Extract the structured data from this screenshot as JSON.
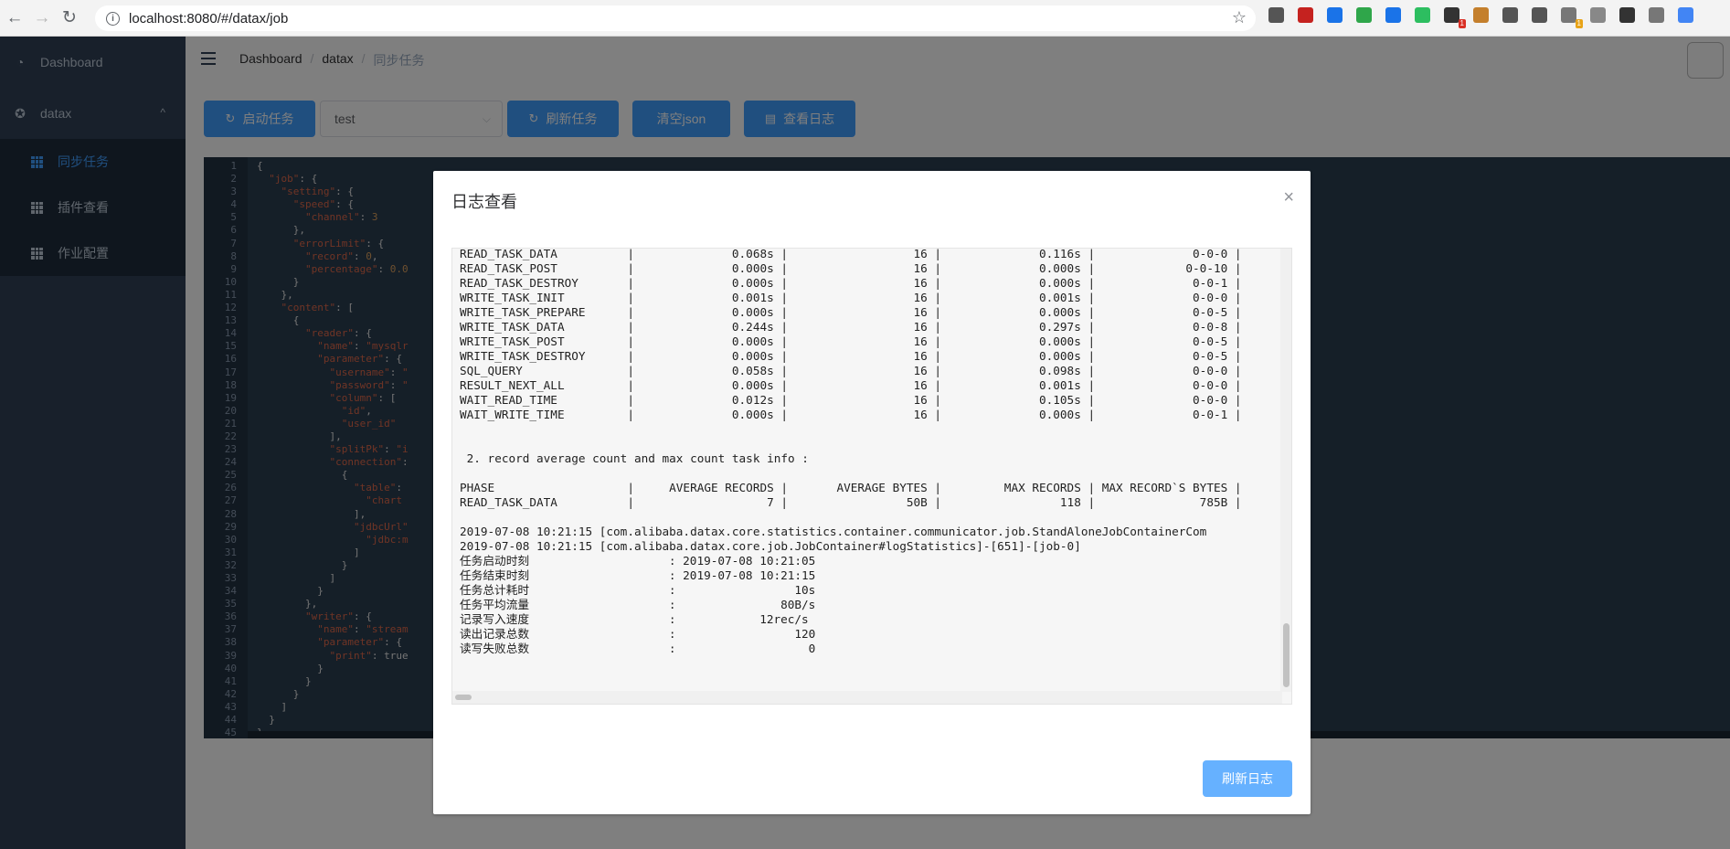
{
  "browser": {
    "back": "←",
    "forward": "→",
    "reload": "↻",
    "url": "localhost:8080/#/datax/job",
    "star": "☆",
    "extensions": [
      {
        "color": "#555555",
        "badge": ""
      },
      {
        "color": "#c5221f",
        "badge": ""
      },
      {
        "color": "#1a73e8",
        "badge": ""
      },
      {
        "color": "#2fa64a",
        "badge": ""
      },
      {
        "color": "#1a73e8",
        "badge": ""
      },
      {
        "color": "#2dbe60",
        "badge": ""
      },
      {
        "color": "#333333",
        "badge": "1"
      },
      {
        "color": "#c47f2c",
        "badge": ""
      },
      {
        "color": "#555555",
        "badge": ""
      },
      {
        "color": "#555555",
        "badge": ""
      },
      {
        "color": "#777777",
        "badge": "1"
      },
      {
        "color": "#888888",
        "badge": ""
      },
      {
        "color": "#333333",
        "badge": ""
      },
      {
        "color": "#777777",
        "badge": ""
      },
      {
        "color": "#4285f4",
        "badge": ""
      }
    ]
  },
  "sidebar": {
    "dashboard": {
      "label": "Dashboard",
      "icon": "dashboard-icon"
    },
    "datax": {
      "label": "datax",
      "icon": "datax-icon",
      "arrow": "^"
    },
    "items": [
      {
        "label": "同步任务",
        "active": true
      },
      {
        "label": "插件查看",
        "active": false
      },
      {
        "label": "作业配置",
        "active": false
      }
    ]
  },
  "breadcrumb": {
    "items": [
      "Dashboard",
      "datax",
      "同步任务"
    ],
    "separator": "/"
  },
  "toolbar": {
    "start_label": "启动任务",
    "select_value": "test",
    "refresh_label": "刷新任务",
    "clear_label": "清空json",
    "log_label": "查看日志"
  },
  "editor": {
    "line_numbers": [
      "1",
      "2",
      "3",
      "4",
      "5",
      "6",
      "7",
      "8",
      "9",
      "10",
      "11",
      "12",
      "13",
      "14",
      "15",
      "16",
      "17",
      "18",
      "19",
      "20",
      "21",
      "22",
      "23",
      "24",
      "25",
      "26",
      "27",
      "28",
      "29",
      "30",
      "31",
      "32",
      "33",
      "34",
      "35",
      "36",
      "37",
      "38",
      "39",
      "40",
      "41",
      "42",
      "43",
      "44",
      "45"
    ],
    "lines": [
      "{",
      "  \"job\": {",
      "    \"setting\": {",
      "      \"speed\": {",
      "        \"channel\": 3",
      "      },",
      "      \"errorLimit\": {",
      "        \"record\": 0,",
      "        \"percentage\": 0.0",
      "      }",
      "    },",
      "    \"content\": [",
      "      {",
      "        \"reader\": {",
      "          \"name\": \"mysqlr",
      "          \"parameter\": {",
      "            \"username\": \"",
      "            \"password\": \"",
      "            \"column\": [",
      "              \"id\",",
      "              \"user_id\"",
      "            ],",
      "            \"splitPk\": \"i",
      "            \"connection\":",
      "              {",
      "                \"table\":",
      "                  \"chart",
      "                ],",
      "                \"jdbcUrl\"",
      "                  \"jdbc:m",
      "                ]",
      "              }",
      "            ]",
      "          }",
      "        },",
      "        \"writer\": {",
      "          \"name\": \"stream",
      "          \"parameter\": {",
      "            \"print\": true",
      "          }",
      "        }",
      "      }",
      "    ]",
      "  }",
      "}"
    ]
  },
  "modal": {
    "title": "日志查看",
    "close": "×",
    "refresh_log_label": "刷新日志",
    "log_lines": [
      "READ_TASK_DATA          |              0.068s |                  16 |              0.116s |              0-0-0 |",
      "READ_TASK_POST          |              0.000s |                  16 |              0.000s |             0-0-10 |",
      "READ_TASK_DESTROY       |              0.000s |                  16 |              0.000s |              0-0-1 |",
      "WRITE_TASK_INIT         |              0.001s |                  16 |              0.001s |              0-0-0 |",
      "WRITE_TASK_PREPARE      |              0.000s |                  16 |              0.000s |              0-0-5 |",
      "WRITE_TASK_DATA         |              0.244s |                  16 |              0.297s |              0-0-8 |",
      "WRITE_TASK_POST         |              0.000s |                  16 |              0.000s |              0-0-5 |",
      "WRITE_TASK_DESTROY      |              0.000s |                  16 |              0.000s |              0-0-5 |",
      "SQL_QUERY               |              0.058s |                  16 |              0.098s |              0-0-0 |",
      "RESULT_NEXT_ALL         |              0.000s |                  16 |              0.001s |              0-0-0 |",
      "WAIT_READ_TIME          |              0.012s |                  16 |              0.105s |              0-0-0 |",
      "WAIT_WRITE_TIME         |              0.000s |                  16 |              0.000s |              0-0-1 |",
      "",
      "",
      " 2. record average count and max count task info :",
      "",
      "PHASE                   |     AVERAGE RECORDS |       AVERAGE BYTES |         MAX RECORDS | MAX RECORD`S BYTES |",
      "READ_TASK_DATA          |                   7 |                 50B |                 118 |               785B |",
      "",
      "2019-07-08 10:21:15 [com.alibaba.datax.core.statistics.container.communicator.job.StandAloneJobContainerCom",
      "2019-07-08 10:21:15 [com.alibaba.datax.core.job.JobContainer#logStatistics]-[651]-[job-0]",
      "任务启动时刻                    : 2019-07-08 10:21:05",
      "任务结束时刻                    : 2019-07-08 10:21:15",
      "任务总计耗时                    :                 10s",
      "任务平均流量                    :               80B/s",
      "记录写入速度                    :            12rec/s",
      "读出记录总数                    :                 120",
      "读写失败总数                    :                   0"
    ]
  }
}
